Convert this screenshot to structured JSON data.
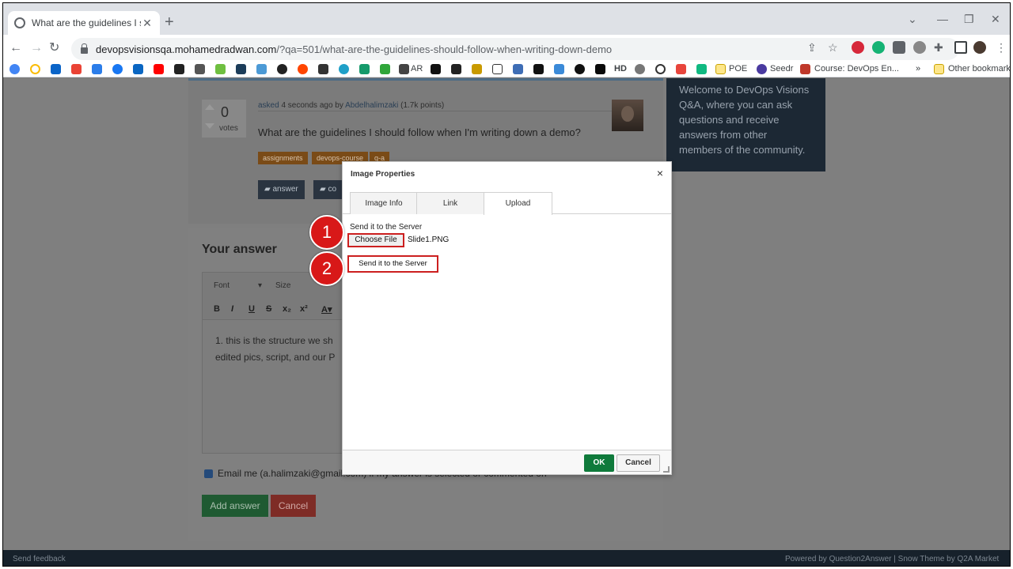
{
  "browser": {
    "tab_title": "What are the guidelines I should",
    "url_host": "devopsvisionsqa.mohamedradwan.com",
    "url_path": "/?qa=501/what-are-the-guidelines-should-follow-when-writing-down-demo",
    "bookmarks": {
      "ar": "AR",
      "hd": "HD",
      "poe": "POE",
      "seedr": "Seedr",
      "course": "Course: DevOps En...",
      "overflow": "»",
      "other": "Other bookmarks"
    }
  },
  "question": {
    "votes": "0",
    "votes_label": "votes",
    "asked_label": "asked",
    "asked_time": "4 seconds ago by",
    "author": "Abdelhalimzaki",
    "points": "(1.7k points)",
    "text": "What are the guidelines I should follow when I'm writing down a demo?",
    "tags": [
      "assignments",
      "devops-course",
      "q-a"
    ],
    "answer_button": "answer",
    "comment_button": "co"
  },
  "sidebar": {
    "welcome_text": "Welcome to DevOps Visions Q&A, where you can ask questions and receive answers from other members of the community."
  },
  "answer_form": {
    "title": "Your answer",
    "font_label": "Font",
    "size_label": "Size",
    "editor_text_line1": "1. this is the structure we sh",
    "editor_text_line2": "edited pics, script, and our P",
    "email_label": "Email me (a.halimzaki@gmail.com) if my answer is selected or commented on",
    "add_answer": "Add answer",
    "cancel": "Cancel"
  },
  "footer": {
    "left": "Send feedback",
    "right": "Powered by Question2Answer   |   Snow Theme by Q2A Market"
  },
  "dialog": {
    "title": "Image Properties",
    "close": "×",
    "tabs": [
      "Image Info",
      "Link",
      "Upload"
    ],
    "active_tab": "Upload",
    "send_label": "Send it to the Server",
    "choose_file": "Choose File",
    "file_name": "Slide1.PNG",
    "send_button": "Send it to the Server",
    "ok": "OK",
    "cancel": "Cancel"
  },
  "annotations": {
    "marker1": "1",
    "marker2": "2"
  },
  "colors": {
    "annotation_red": "#d81818",
    "ok_green": "#0f7a3b"
  }
}
